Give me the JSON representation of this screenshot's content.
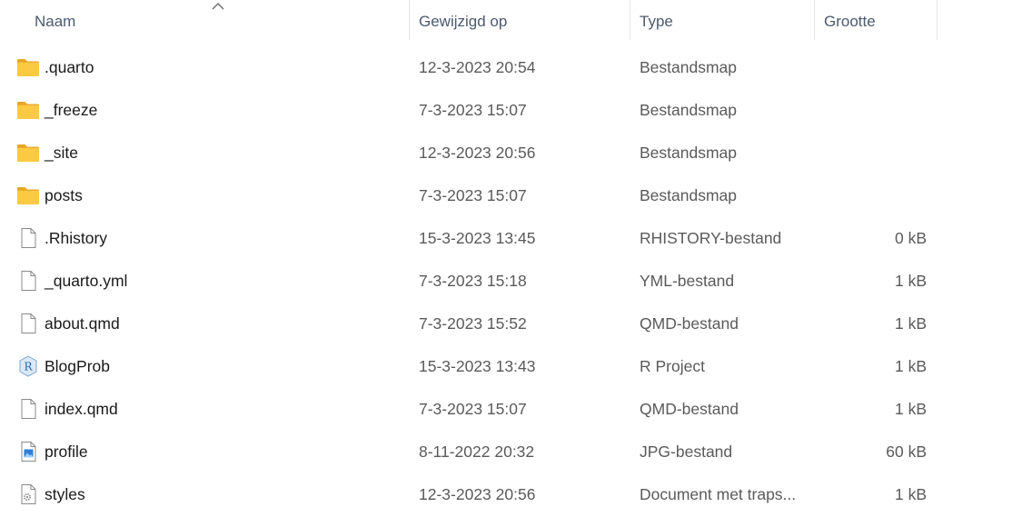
{
  "columns": {
    "name": "Naam",
    "date": "Gewijzigd op",
    "type": "Type",
    "size": "Grootte"
  },
  "files": [
    {
      "name": ".quarto",
      "date": "12-3-2023 20:54",
      "type": "Bestandsmap",
      "size": "",
      "icon": "folder-icon"
    },
    {
      "name": "_freeze",
      "date": "7-3-2023 15:07",
      "type": "Bestandsmap",
      "size": "",
      "icon": "folder-icon"
    },
    {
      "name": "_site",
      "date": "12-3-2023 20:56",
      "type": "Bestandsmap",
      "size": "",
      "icon": "folder-icon"
    },
    {
      "name": "posts",
      "date": "7-3-2023 15:07",
      "type": "Bestandsmap",
      "size": "",
      "icon": "folder-icon"
    },
    {
      "name": ".Rhistory",
      "date": "15-3-2023 13:45",
      "type": "RHISTORY-bestand",
      "size": "0 kB",
      "icon": "file-icon"
    },
    {
      "name": "_quarto.yml",
      "date": "7-3-2023 15:18",
      "type": "YML-bestand",
      "size": "1 kB",
      "icon": "file-icon"
    },
    {
      "name": "about.qmd",
      "date": "7-3-2023 15:52",
      "type": "QMD-bestand",
      "size": "1 kB",
      "icon": "file-icon"
    },
    {
      "name": "BlogProb",
      "date": "15-3-2023 13:43",
      "type": "R Project",
      "size": "1 kB",
      "icon": "rproject-icon"
    },
    {
      "name": "index.qmd",
      "date": "7-3-2023 15:07",
      "type": "QMD-bestand",
      "size": "1 kB",
      "icon": "file-icon"
    },
    {
      "name": "profile",
      "date": "8-11-2022 20:32",
      "type": "JPG-bestand",
      "size": "60 kB",
      "icon": "image-icon"
    },
    {
      "name": "styles",
      "date": "12-3-2023 20:56",
      "type": "Document met traps...",
      "size": "1 kB",
      "icon": "stylesheet-icon"
    }
  ]
}
